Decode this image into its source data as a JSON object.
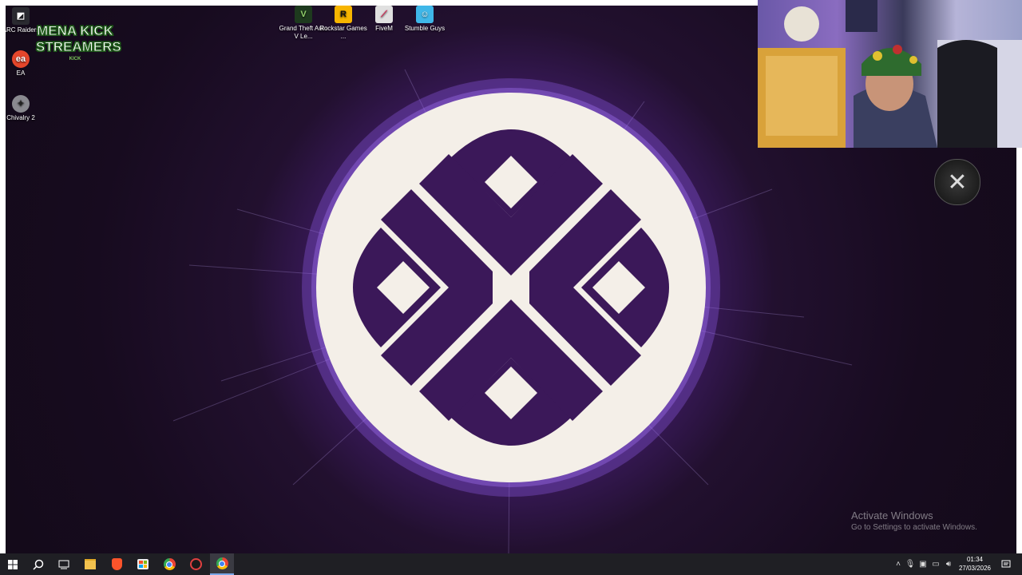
{
  "desktop_icons": [
    {
      "label": "ARC Raiders",
      "icon": "arc-raiders-icon"
    },
    {
      "label": "EA",
      "icon": "ea-icon"
    },
    {
      "label": "Chivalry 2",
      "icon": "chivalry-icon"
    },
    {
      "label": "Grand Theft Auto V Le...",
      "icon": "gta-icon"
    },
    {
      "label": "Rockstar Games ...",
      "icon": "rockstar-icon"
    },
    {
      "label": "FiveM",
      "icon": "fivem-icon"
    },
    {
      "label": "Stumble Guys",
      "icon": "stumble-guys-icon"
    }
  ],
  "overlay_badge": {
    "line1": "MENA KICK",
    "line2": "STREAMERS",
    "small": "KICK"
  },
  "activation_notice": {
    "title": "Activate Windows",
    "subtitle": "Go to Settings to activate Windows."
  },
  "taskbar": {
    "pinned": [
      "windows-start-icon",
      "search-icon",
      "task-view-icon",
      "file-explorer-icon",
      "brave-browser-icon",
      "microsoft-store-icon",
      "chrome-icon",
      "app-icon",
      "chrome-icon"
    ],
    "clock_time": "01:34",
    "clock_date": "27/03/2026"
  },
  "colors": {
    "wallpaper_purple": "#3a1a5c",
    "logo_cream": "#f4efe8",
    "logo_purple": "#3b1859",
    "taskbar": "#1f1f24"
  }
}
